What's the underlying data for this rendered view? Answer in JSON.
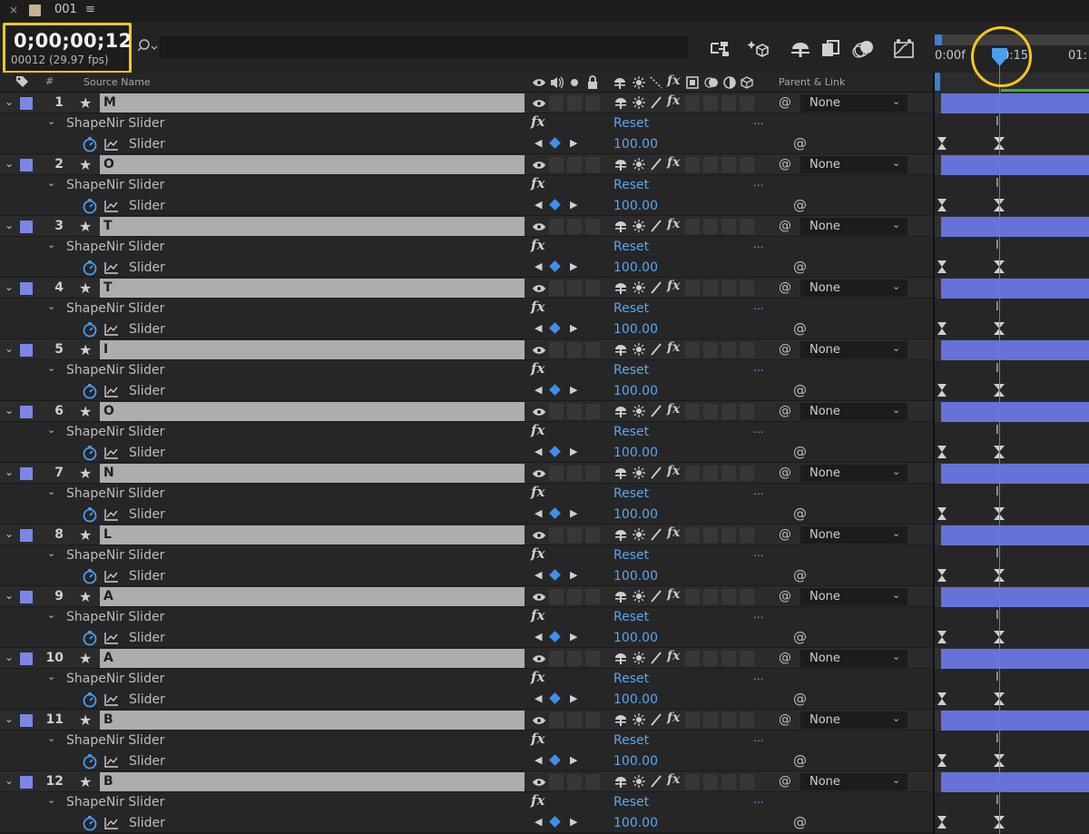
{
  "tab": {
    "name": "001",
    "close": "×",
    "menu": "≡"
  },
  "header": {
    "timecode": "0;00;00;12",
    "frames": "00012 (29.97 fps)"
  },
  "timeline": {
    "ticks": [
      "0:00f",
      "0:15",
      "01:"
    ],
    "cti_frame": 12
  },
  "columns": {
    "number": "#",
    "source_name": "Source Name",
    "parent_link": "Parent & Link"
  },
  "colors": {
    "label": "#7b86e6",
    "layer_bar": "#6672d8",
    "accent": "#5aa6f2",
    "highlight": "#f6c61a"
  },
  "icons": {
    "tools": [
      "comp-flowchart-icon",
      "draft-3d-icon",
      "shy-layers-icon",
      "frame-blending-icon",
      "motion-blur-icon",
      "graph-editor-icon"
    ],
    "switches": [
      "shy-icon",
      "quality-icon",
      "effect-icon",
      "fx-icon"
    ]
  },
  "layers": [
    {
      "num": "1",
      "name": "M",
      "parent": "None",
      "effect": "ShapeNir Slider",
      "reset": "Reset",
      "dots": "...",
      "property": "Slider",
      "value": "100.00"
    },
    {
      "num": "2",
      "name": "O",
      "parent": "None",
      "effect": "ShapeNir Slider",
      "reset": "Reset",
      "dots": "...",
      "property": "Slider",
      "value": "100.00"
    },
    {
      "num": "3",
      "name": "T",
      "parent": "None",
      "effect": "ShapeNir Slider",
      "reset": "Reset",
      "dots": "...",
      "property": "Slider",
      "value": "100.00"
    },
    {
      "num": "4",
      "name": "T",
      "parent": "None",
      "effect": "ShapeNir Slider",
      "reset": "Reset",
      "dots": "...",
      "property": "Slider",
      "value": "100.00"
    },
    {
      "num": "5",
      "name": "I",
      "parent": "None",
      "effect": "ShapeNir Slider",
      "reset": "Reset",
      "dots": "...",
      "property": "Slider",
      "value": "100.00"
    },
    {
      "num": "6",
      "name": "O",
      "parent": "None",
      "effect": "ShapeNir Slider",
      "reset": "Reset",
      "dots": "...",
      "property": "Slider",
      "value": "100.00"
    },
    {
      "num": "7",
      "name": "N",
      "parent": "None",
      "effect": "ShapeNir Slider",
      "reset": "Reset",
      "dots": "...",
      "property": "Slider",
      "value": "100.00"
    },
    {
      "num": "8",
      "name": "L",
      "parent": "None",
      "effect": "ShapeNir Slider",
      "reset": "Reset",
      "dots": "...",
      "property": "Slider",
      "value": "100.00"
    },
    {
      "num": "9",
      "name": "A",
      "parent": "None",
      "effect": "ShapeNir Slider",
      "reset": "Reset",
      "dots": "...",
      "property": "Slider",
      "value": "100.00"
    },
    {
      "num": "10",
      "name": "A",
      "parent": "None",
      "effect": "ShapeNir Slider",
      "reset": "Reset",
      "dots": "...",
      "property": "Slider",
      "value": "100.00"
    },
    {
      "num": "11",
      "name": "B",
      "parent": "None",
      "effect": "ShapeNir Slider",
      "reset": "Reset",
      "dots": "...",
      "property": "Slider",
      "value": "100.00"
    },
    {
      "num": "12",
      "name": "B",
      "parent": "None",
      "effect": "ShapeNir Slider",
      "reset": "Reset",
      "dots": "...",
      "property": "Slider",
      "value": "100.00"
    }
  ]
}
